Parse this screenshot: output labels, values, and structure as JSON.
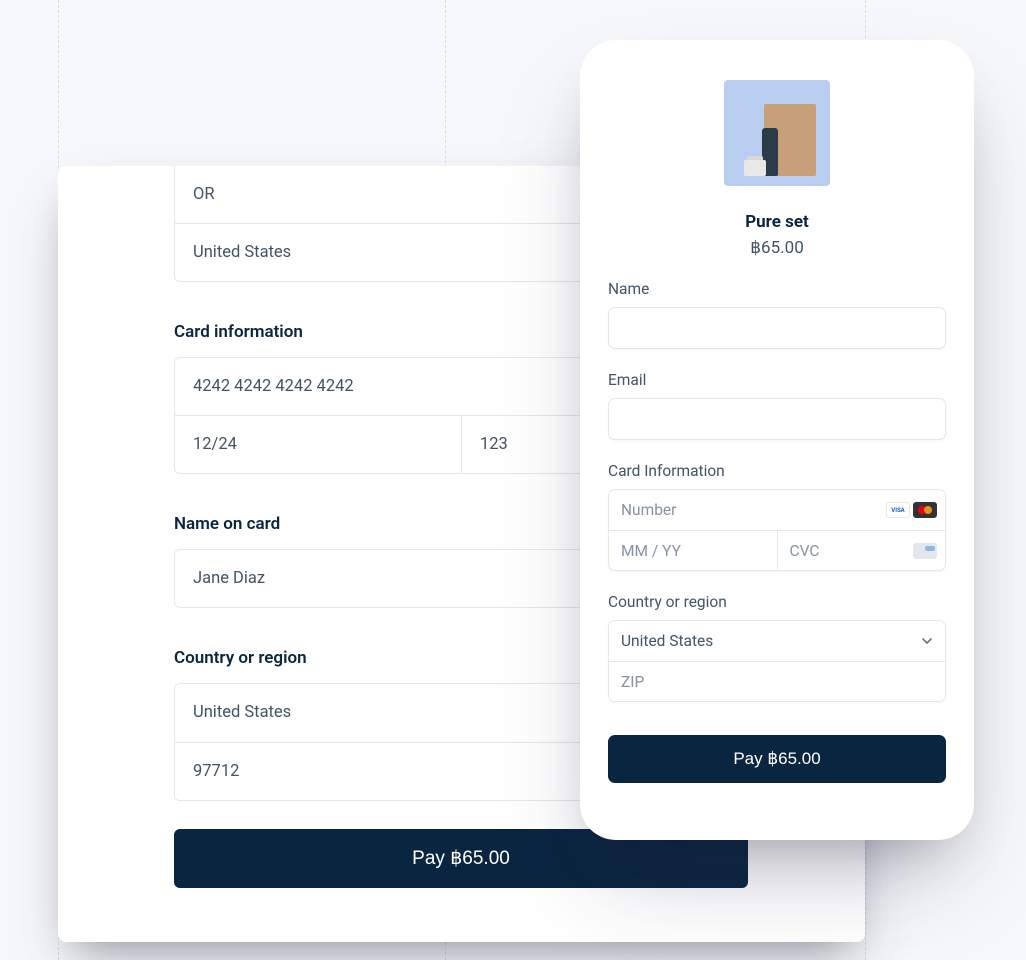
{
  "desktop": {
    "address": {
      "state": "OR",
      "country": "United States"
    },
    "card_info_label": "Card information",
    "card": {
      "number": "4242 4242 4242 4242",
      "expiry": "12/24",
      "cvc": "123"
    },
    "name_on_card_label": "Name on card",
    "name_on_card": "Jane Diaz",
    "country_label": "Country or region",
    "country": "United States",
    "zip": "97712",
    "pay_button": "Pay ฿65.00"
  },
  "mobile": {
    "product_name": "Pure set",
    "product_price": "฿65.00",
    "name_label": "Name",
    "email_label": "Email",
    "card_label": "Card Information",
    "card_number_placeholder": "Number",
    "card_expiry_placeholder": "MM / YY",
    "card_cvc_placeholder": "CVC",
    "country_label": "Country or region",
    "country_value": "United States",
    "zip_placeholder": "ZIP",
    "pay_button": "Pay ฿65.00"
  }
}
